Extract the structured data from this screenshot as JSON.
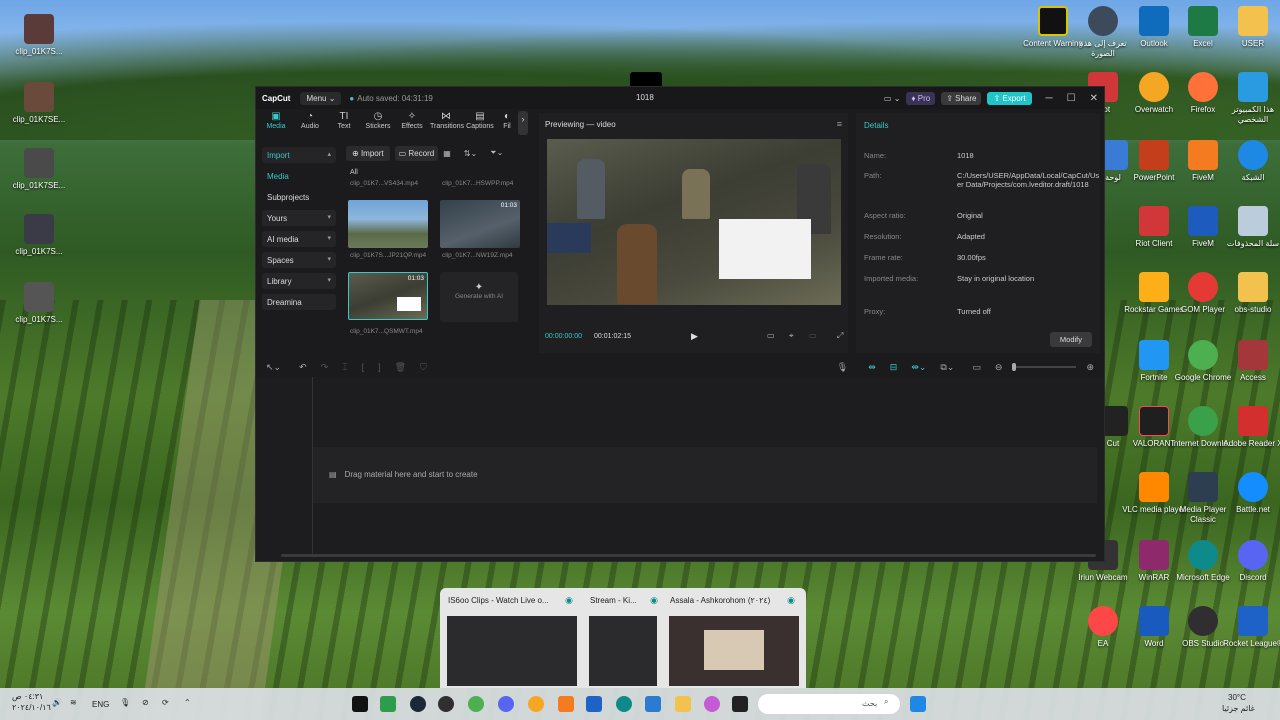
{
  "desktop": {
    "left_icons": [
      "clip_01K7S...",
      "clip_01K7SE...",
      "clip_01K7SE...",
      "clip_01K7S...",
      "clip_01K7S..."
    ],
    "right_icons": [
      "Content Warning",
      "تعرف إلى هذه الصورة",
      "Outlook",
      "Excel",
      "USER",
      "Riot",
      "Overwatch",
      "Firefox",
      "هذا الكمبيوتر الشخصي",
      "لوحة",
      "PowerPoint",
      "FiveM",
      "الشبكة",
      "Riot Client",
      "FiveM",
      "سلة المحذوفات",
      "Rockstar Games",
      "GOM Player",
      "obs-studio",
      "Fortnite",
      "Google Chrome",
      "Access",
      "Cut",
      "VALORANT",
      "Internet Downlo...",
      "Adobe Reader X",
      "VLC media player",
      "Media Player Classic",
      "Battle.net",
      "Iriun Webcam",
      "WinRAR",
      "Microsoft Edge",
      "Discord",
      "EA",
      "Word",
      "OBS Studio",
      "Rocket League®"
    ]
  },
  "capcut": {
    "logo": "CapCut",
    "menu": "Menu",
    "autosave": "Auto saved: 04:31:19",
    "window_title": "1018",
    "pro": "Pro",
    "share": "Share",
    "export": "Export",
    "tools": [
      "Media",
      "Audio",
      "Text",
      "Stickers",
      "Effects",
      "Transitions",
      "Captions",
      "Fil"
    ],
    "left_nav": [
      "Import",
      "Media",
      "Subprojects",
      "Yours",
      "AI media",
      "Spaces",
      "Library",
      "Dreamina"
    ],
    "import_btn": "Import",
    "record_btn": "Record",
    "all_label": "All",
    "files": [
      "clip_01K7...VS434.mp4",
      "clip_01K7...HSWPP.mp4",
      "clip_01K7S...JP21QP.mp4",
      "clip_01K7...NW19Z.mp4",
      "clip_01K7...QSMWT.mp4"
    ],
    "durations": [
      "01:03",
      "01:03"
    ],
    "generate_ai": "Generate with AI",
    "preview_title": "Previewing — video",
    "time_current": "00:00:00:00",
    "time_total": "00:01:02:15",
    "details": {
      "title": "Details",
      "rows": [
        {
          "label": "Name:",
          "value": "1018"
        },
        {
          "label": "Path:",
          "value": "C:/Users/USER/AppData/Local/CapCut/User Data/Projects/com.lveditor.draft/1018"
        },
        {
          "label": "Aspect ratio:",
          "value": "Original"
        },
        {
          "label": "Resolution:",
          "value": "Adapted"
        },
        {
          "label": "Frame rate:",
          "value": "30.00fps"
        },
        {
          "label": "Imported media:",
          "value": "Stay in original location"
        },
        {
          "label": "Proxy:",
          "value": "Turned off"
        }
      ],
      "modify": "Modify"
    },
    "drag_message": "Drag material here and start to create"
  },
  "taskbar_previews": [
    "IS6oo Clips - Watch Live o...",
    "Stream - Ki...",
    "Assala - Ashkorohom (٢٠٢٤)"
  ],
  "taskbar": {
    "time": "٠٤:٣١ ص",
    "date": "٢٠٢٤/١٠/١٦",
    "lang": "ENG",
    "search": "بحث",
    "weather_temp": "30°C",
    "weather_text": "غائم جزئيا"
  }
}
